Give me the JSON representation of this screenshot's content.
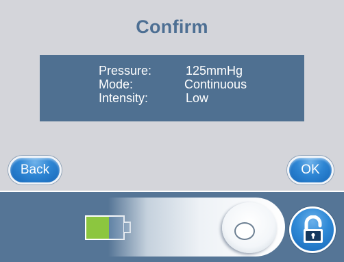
{
  "header": {
    "title": "Confirm"
  },
  "settings": [
    {
      "label": "Pressure:",
      "value": "125mmHg"
    },
    {
      "label": "Mode:",
      "value": "Continuous"
    },
    {
      "label": "Intensity:",
      "value": "Low"
    }
  ],
  "buttons": {
    "back_label": "Back",
    "ok_label": "OK"
  },
  "status_bar": {
    "battery_level": 0.62,
    "battery_color": "#8cc63f",
    "slider_state": "unlock-slider",
    "lock_icon": "padlock-unlocked-icon"
  },
  "colors": {
    "panel_bg": "#d4d5da",
    "title_color": "#4d6f93",
    "info_box_bg": "#4f7091",
    "button_blue": "#2e86d4",
    "bar_bg": "#557596"
  }
}
